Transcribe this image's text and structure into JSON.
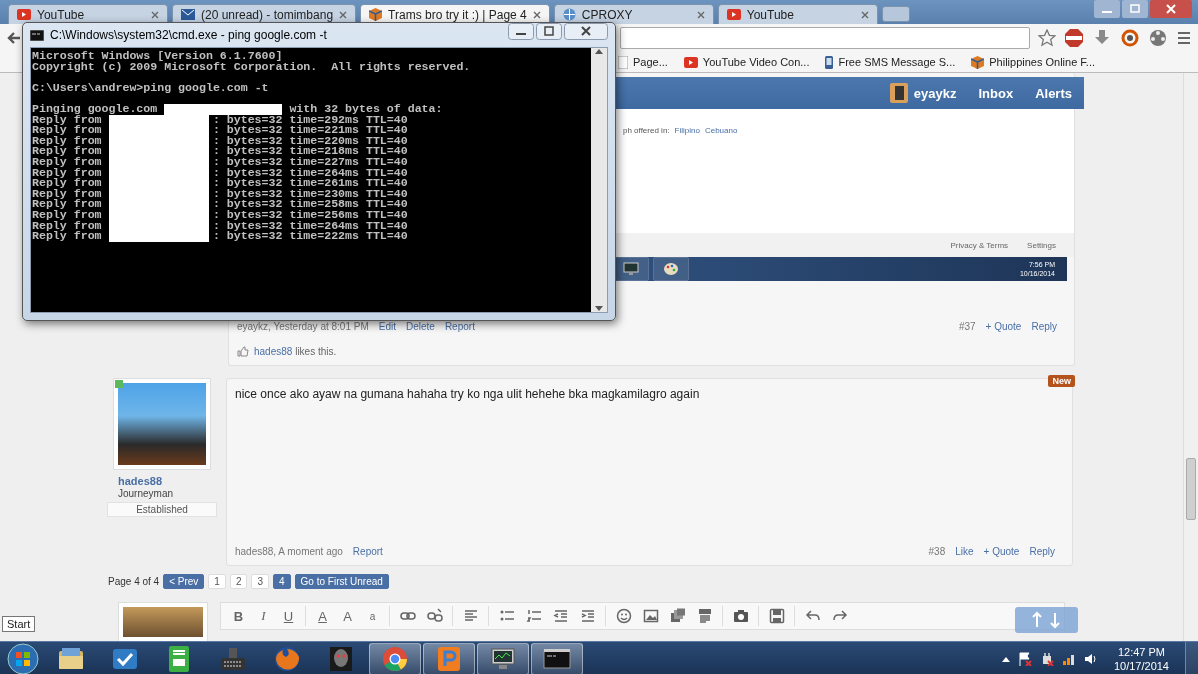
{
  "browser": {
    "tabs": [
      {
        "title": "YouTube",
        "kind": "youtube",
        "selected": false
      },
      {
        "title": "(20 unread) - tomimbang",
        "kind": "mail",
        "selected": false
      },
      {
        "title": "Trams bro try it :) | Page 4",
        "kind": "forum",
        "selected": true
      },
      {
        "title": "CPROXY",
        "kind": "proxy",
        "selected": false
      },
      {
        "title": "YouTube",
        "kind": "youtube",
        "selected": false
      }
    ],
    "bookmarks": [
      {
        "title": "Page...",
        "kind": "page"
      },
      {
        "title": "YouTube Video Con...",
        "kind": "youtube"
      },
      {
        "title": "Free SMS Message S...",
        "kind": "phone"
      },
      {
        "title": "Philippines Online F...",
        "kind": "forum"
      }
    ]
  },
  "forum": {
    "embedded_screenshot": {
      "username": "eyaykz",
      "nav": [
        "Inbox",
        "Alerts"
      ],
      "language_label": "ph offered in:",
      "languages": [
        "Filipino",
        "Cebuano"
      ],
      "footer_links": [
        "Privacy & Terms",
        "Settings"
      ],
      "clock_time": "7:56 PM",
      "clock_date": "10/16/2014"
    },
    "post_37": {
      "meta": "eyaykz, Yesterday at 8:01 PM",
      "actions": [
        "Edit",
        "Delete",
        "Report"
      ],
      "number": "#37",
      "right_actions": [
        "+ Quote",
        "Reply"
      ],
      "likes_user": "hades88",
      "likes_text": "likes this."
    },
    "post_38": {
      "author": "hades88",
      "rank": "Journeyman",
      "banner": "Established",
      "online": true,
      "badge": "New",
      "message": "nice once ako ayaw na gumana hahaha try ko nga ulit hehehe bka magkamilagro again",
      "meta": "hades88, A moment ago",
      "actions": [
        "Report"
      ],
      "number": "#38",
      "right_actions": [
        "Like",
        "+ Quote",
        "Reply"
      ]
    },
    "pagination": {
      "label": "Page 4 of 4",
      "prev": "< Prev",
      "pages": [
        {
          "label": "1",
          "selected": false
        },
        {
          "label": "2",
          "selected": false
        },
        {
          "label": "3",
          "selected": false
        },
        {
          "label": "4",
          "selected": true
        }
      ],
      "jump": "Go to First Unread"
    },
    "editor_toolbar": [
      {
        "kind": "bold",
        "label": "B"
      },
      {
        "kind": "italic",
        "label": "I"
      },
      {
        "kind": "underline",
        "label": "U"
      },
      {
        "kind": "sep"
      },
      {
        "kind": "color",
        "label": "A"
      },
      {
        "kind": "size",
        "label": "A"
      },
      {
        "kind": "font",
        "label": "a"
      },
      {
        "kind": "sep"
      },
      {
        "kind": "link"
      },
      {
        "kind": "unlink"
      },
      {
        "kind": "sep"
      },
      {
        "kind": "align"
      },
      {
        "kind": "sep"
      },
      {
        "kind": "bullets"
      },
      {
        "kind": "numbers"
      },
      {
        "kind": "outdent"
      },
      {
        "kind": "indent"
      },
      {
        "kind": "sep"
      },
      {
        "kind": "smiley"
      },
      {
        "kind": "image"
      },
      {
        "kind": "media"
      },
      {
        "kind": "code"
      },
      {
        "kind": "sep"
      },
      {
        "kind": "camera"
      },
      {
        "kind": "sep"
      },
      {
        "kind": "save"
      },
      {
        "kind": "sep"
      },
      {
        "kind": "undo"
      },
      {
        "kind": "redo"
      }
    ]
  },
  "cmd": {
    "title": "C:\\Windows\\system32\\cmd.exe - ping  google.com -t",
    "lines": [
      {
        "kind": "text",
        "text": "Microsoft Windows [Version 6.1.7600]"
      },
      {
        "kind": "text",
        "text": "Copyright (c) 2009 Microsoft Corporation.  All rights reserved."
      },
      {
        "kind": "blank"
      },
      {
        "kind": "text",
        "text": "C:\\Users\\andrew>ping google.com -t"
      },
      {
        "kind": "blank"
      },
      {
        "kind": "ping-header",
        "before": "Pinging google.com",
        "after": "with 32 bytes of data:"
      },
      {
        "kind": "reply",
        "before": "Reply from",
        "after": ": bytes=32 time=292ms TTL=40"
      },
      {
        "kind": "reply",
        "before": "Reply from",
        "after": ": bytes=32 time=221ms TTL=40"
      },
      {
        "kind": "reply",
        "before": "Reply from",
        "after": ": bytes=32 time=220ms TTL=40"
      },
      {
        "kind": "reply",
        "before": "Reply from",
        "after": ": bytes=32 time=218ms TTL=40"
      },
      {
        "kind": "reply",
        "before": "Reply from",
        "after": ": bytes=32 time=227ms TTL=40"
      },
      {
        "kind": "reply",
        "before": "Reply from",
        "after": ": bytes=32 time=264ms TTL=40"
      },
      {
        "kind": "reply",
        "before": "Reply from",
        "after": ": bytes=32 time=261ms TTL=40"
      },
      {
        "kind": "reply",
        "before": "Reply from",
        "after": ": bytes=32 time=230ms TTL=40"
      },
      {
        "kind": "reply",
        "before": "Reply from",
        "after": ": bytes=32 time=258ms TTL=40"
      },
      {
        "kind": "reply",
        "before": "Reply from",
        "after": ": bytes=32 time=256ms TTL=40"
      },
      {
        "kind": "reply",
        "before": "Reply from",
        "after": ": bytes=32 time=264ms TTL=40"
      },
      {
        "kind": "reply",
        "before": "Reply from",
        "after": ": bytes=32 time=222ms TTL=40"
      }
    ]
  },
  "tooltip": "Start",
  "taskbar": {
    "apps": [
      {
        "kind": "folder",
        "running": false
      },
      {
        "kind": "check",
        "running": false
      },
      {
        "kind": "green-app",
        "running": false
      },
      {
        "kind": "keyboard",
        "running": false
      },
      {
        "kind": "firefox",
        "running": false
      },
      {
        "kind": "game",
        "running": false
      },
      {
        "kind": "chrome",
        "running": true
      },
      {
        "kind": "orange-p",
        "running": true
      },
      {
        "kind": "monitor",
        "running": true
      },
      {
        "kind": "console",
        "running": true
      }
    ],
    "time": "12:47 PM",
    "date": "10/17/2014"
  }
}
